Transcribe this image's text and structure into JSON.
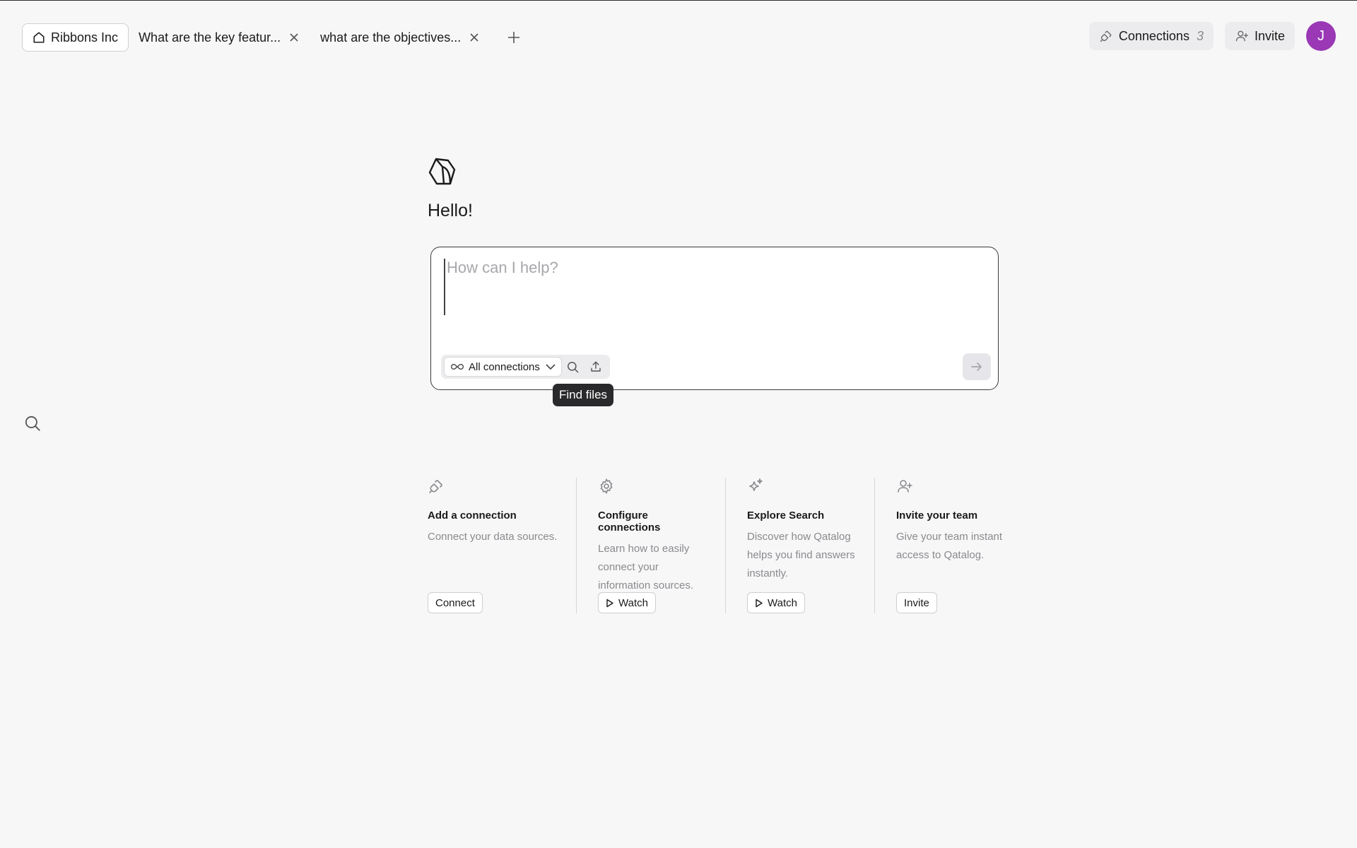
{
  "tabs": {
    "home": {
      "label": "Ribbons Inc",
      "icon": "home-icon"
    },
    "items": [
      {
        "label": "What are the key featur..."
      },
      {
        "label": "what are the objectives..."
      }
    ],
    "new_tab_icon": "plus-icon"
  },
  "header": {
    "connections_label": "Connections",
    "connections_count": "3",
    "invite_label": "Invite",
    "avatar_initial": "J",
    "avatar_color": "#9a38b5"
  },
  "hero": {
    "greeting": "Hello!"
  },
  "prompt": {
    "placeholder": "How can I help?",
    "connections_select": "All connections",
    "tooltip": "Find files"
  },
  "cards": [
    {
      "icon": "plug-icon",
      "title": "Add a connection",
      "description": "Connect your data sources.",
      "button": "Connect"
    },
    {
      "icon": "gear-icon",
      "title": "Configure connections",
      "description": "Learn how to easily connect your information sources.",
      "button": "Watch"
    },
    {
      "icon": "sparkle-icon",
      "title": "Explore Search",
      "description": "Discover how Qatalog helps you find answers instantly.",
      "button": "Watch"
    },
    {
      "icon": "user-plus-icon",
      "title": "Invite your team",
      "description": "Give your team instant access to Qatalog.",
      "button": "Invite"
    }
  ]
}
